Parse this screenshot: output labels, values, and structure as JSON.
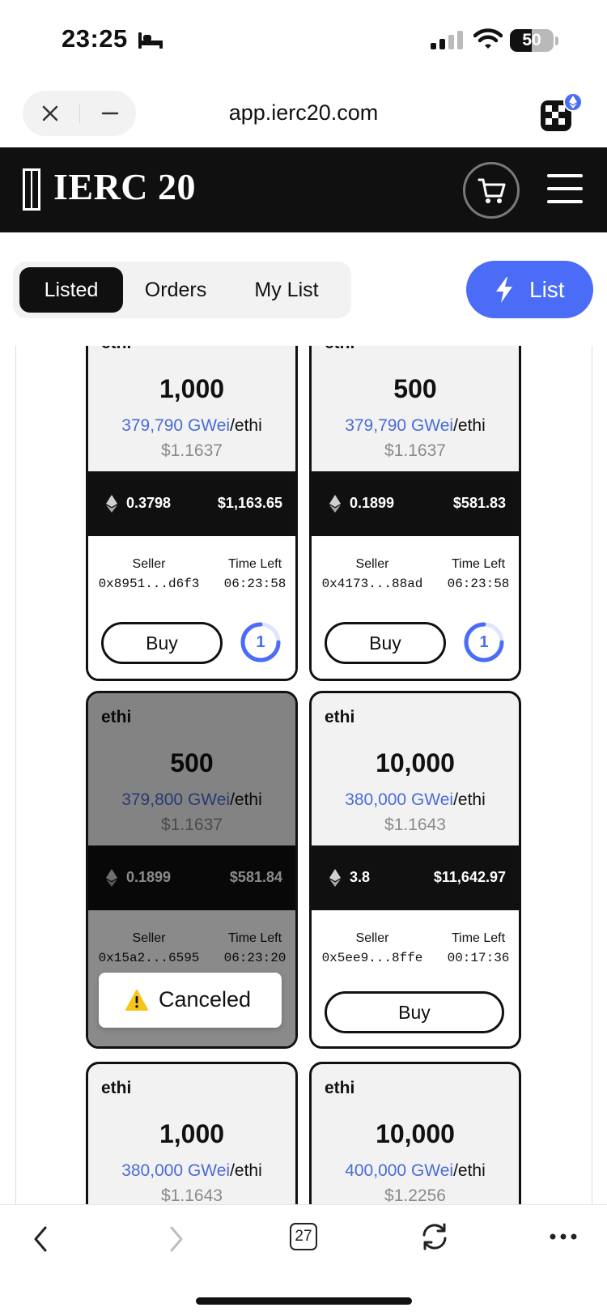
{
  "status_bar": {
    "time": "23:25",
    "battery": "50",
    "battery_level": 0.5
  },
  "browser": {
    "url": "app.ierc20.com"
  },
  "header": {
    "logo_text": "IERC 20"
  },
  "tabs": [
    {
      "label": "Listed",
      "active": true
    },
    {
      "label": "Orders",
      "active": false
    },
    {
      "label": "My List",
      "active": false
    }
  ],
  "list_button": {
    "label": "List"
  },
  "cards": [
    {
      "ticker": "ethi",
      "amount": "1,000",
      "price_gwei": "379,790 GWei",
      "price_unit": "/ethi",
      "usd_unit_price": "$1.1637",
      "eth_total": "0.3798",
      "usd_total": "$1,163.65",
      "seller_label": "Seller",
      "seller": "0x8951...d6f3",
      "time_label": "Time Left",
      "time_left": "06:23:58",
      "buy_label": "Buy",
      "counter": "1",
      "canceled": false
    },
    {
      "ticker": "ethi",
      "amount": "500",
      "price_gwei": "379,790 GWei",
      "price_unit": "/ethi",
      "usd_unit_price": "$1.1637",
      "eth_total": "0.1899",
      "usd_total": "$581.83",
      "seller_label": "Seller",
      "seller": "0x4173...88ad",
      "time_label": "Time Left",
      "time_left": "06:23:58",
      "buy_label": "Buy",
      "counter": "1",
      "canceled": false
    },
    {
      "ticker": "ethi",
      "amount": "500",
      "price_gwei": "379,800 GWei",
      "price_unit": "/ethi",
      "usd_unit_price": "$1.1637",
      "eth_total": "0.1899",
      "usd_total": "$581.84",
      "seller_label": "Seller",
      "seller": "0x15a2...6595",
      "time_label": "Time Left",
      "time_left": "06:23:20",
      "status_label": "Canceled",
      "canceled": true
    },
    {
      "ticker": "ethi",
      "amount": "10,000",
      "price_gwei": "380,000 GWei",
      "price_unit": "/ethi",
      "usd_unit_price": "$1.1643",
      "eth_total": "3.8",
      "usd_total": "$11,642.97",
      "seller_label": "Seller",
      "seller": "0x5ee9...8ffe",
      "time_label": "Time Left",
      "time_left": "00:17:36",
      "buy_label": "Buy",
      "canceled": false
    },
    {
      "ticker": "ethi",
      "amount": "1,000",
      "price_gwei": "380,000 GWei",
      "price_unit": "/ethi",
      "usd_unit_price": "$1.1643"
    },
    {
      "ticker": "ethi",
      "amount": "10,000",
      "price_gwei": "400,000 GWei",
      "price_unit": "/ethi",
      "usd_unit_price": "$1.2256"
    }
  ],
  "bottom_bar": {
    "tab_count": "27"
  },
  "colors": {
    "accent": "#4a6cf7",
    "gwei_text": "#4a6cd6",
    "header_bg": "#101010",
    "card_bg": "#f2f2f2",
    "warning": "#f5c518"
  }
}
